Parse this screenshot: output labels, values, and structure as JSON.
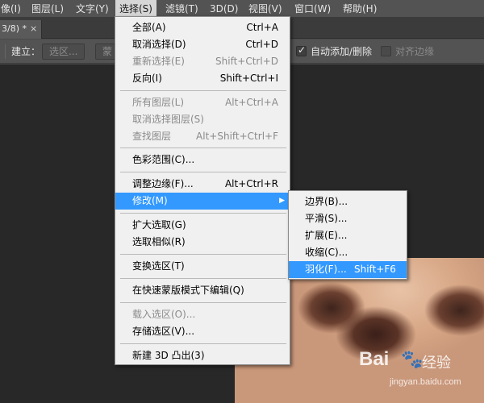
{
  "menubar": {
    "items": [
      "像(I)",
      "图层(L)",
      "文字(Y)",
      "选择(S)",
      "滤镜(T)",
      "3D(D)",
      "视图(V)",
      "窗口(W)",
      "帮助(H)"
    ]
  },
  "tab": {
    "title": "3/8) *",
    "close": "×"
  },
  "options": {
    "build_label": "建立：",
    "selection_button": "选区...",
    "mask_button": "蒙",
    "auto_add_label": "自动添加/删除",
    "align_edges_label": "对齐边缘"
  },
  "menu": {
    "items": [
      {
        "label": "全部(A)",
        "shortcut": "Ctrl+A"
      },
      {
        "label": "取消选择(D)",
        "shortcut": "Ctrl+D"
      },
      {
        "label": "重新选择(E)",
        "shortcut": "Shift+Ctrl+D"
      },
      {
        "label": "反向(I)",
        "shortcut": "Shift+Ctrl+I"
      },
      {
        "label": "所有图层(L)",
        "shortcut": "Alt+Ctrl+A"
      },
      {
        "label": "取消选择图层(S)",
        "shortcut": ""
      },
      {
        "label": "查找图层",
        "shortcut": "Alt+Shift+Ctrl+F"
      },
      {
        "label": "色彩范围(C)...",
        "shortcut": ""
      },
      {
        "label": "调整边缘(F)...",
        "shortcut": "Alt+Ctrl+R"
      },
      {
        "label": "修改(M)",
        "shortcut": ""
      },
      {
        "label": "扩大选取(G)",
        "shortcut": ""
      },
      {
        "label": "选取相似(R)",
        "shortcut": ""
      },
      {
        "label": "变换选区(T)",
        "shortcut": ""
      },
      {
        "label": "在快速蒙版模式下编辑(Q)",
        "shortcut": ""
      },
      {
        "label": "载入选区(O)...",
        "shortcut": ""
      },
      {
        "label": "存储选区(V)...",
        "shortcut": ""
      },
      {
        "label": "新建 3D 凸出(3)",
        "shortcut": ""
      }
    ]
  },
  "submenu": {
    "items": [
      {
        "label": "边界(B)...",
        "shortcut": ""
      },
      {
        "label": "平滑(S)...",
        "shortcut": ""
      },
      {
        "label": "扩展(E)...",
        "shortcut": ""
      },
      {
        "label": "收缩(C)...",
        "shortcut": ""
      },
      {
        "label": "羽化(F)...",
        "shortcut": "Shift+F6"
      }
    ]
  },
  "watermark": {
    "logo": "Bai",
    "text": "经验",
    "url": "jingyan.baidu.com"
  },
  "colors": {
    "highlight": "#3399ff",
    "menu_bg": "#f0f0f0",
    "app_bg": "#535353",
    "canvas_bg": "#282828"
  }
}
